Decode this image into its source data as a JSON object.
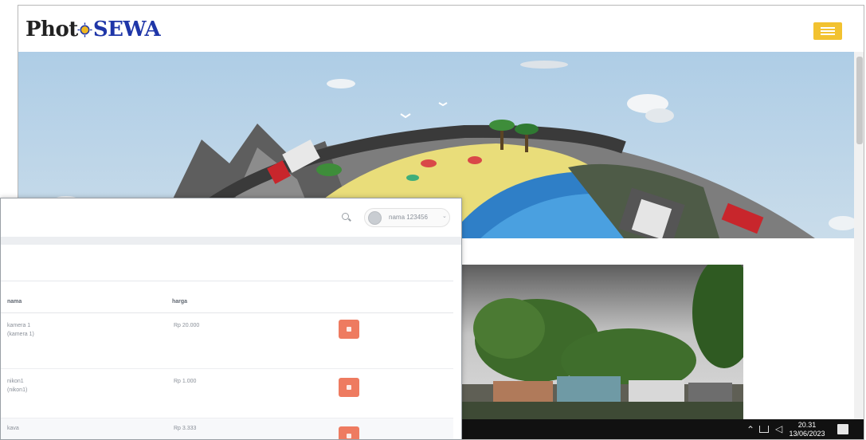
{
  "site": {
    "brand_part1": "Phot",
    "brand_part2": "SEWA",
    "icons": {
      "menu": "hamburger-menu-icon",
      "brand_dot": "sun-icon"
    },
    "colors": {
      "brand_dark": "#222222",
      "brand_blue": "#1f36a8",
      "menu_button": "#f2c230"
    }
  },
  "taskbar": {
    "time": "20.31",
    "date": "13/06/2023",
    "icons": [
      "chevron-up-icon",
      "network-icon",
      "volume-icon",
      "notification-icon"
    ]
  },
  "admin": {
    "user_name": "nama 123456",
    "icons": {
      "search": "search-icon",
      "delete": "trash-icon"
    },
    "table": {
      "headers": [
        "nama",
        "harga"
      ],
      "rows": [
        {
          "name": "kamera 1",
          "sub": "(kamera 1)",
          "price": "Rp 20.000"
        },
        {
          "name": "nikon1",
          "sub": "(nikon1)",
          "price": "Rp 1.000"
        },
        {
          "name": "kava",
          "sub": "",
          "price": "Rp 3.333"
        }
      ]
    },
    "colors": {
      "delete_button": "#ee7b60"
    }
  }
}
